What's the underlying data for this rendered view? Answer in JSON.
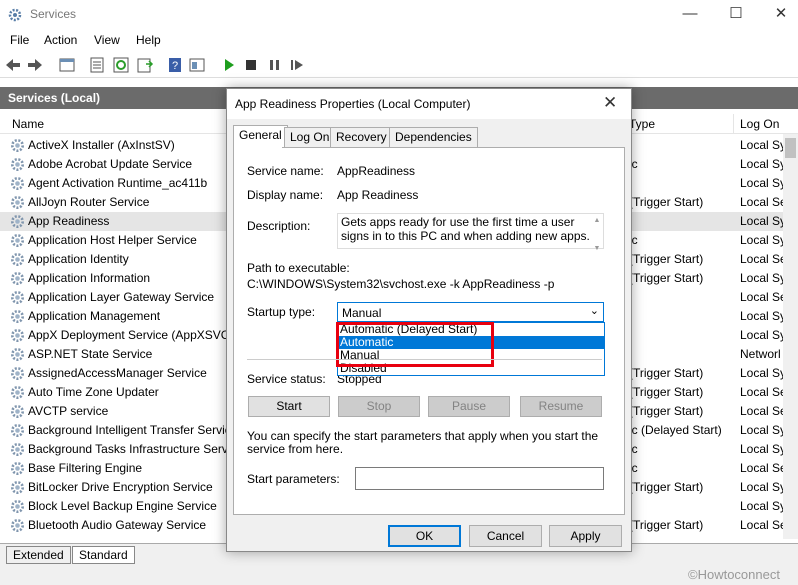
{
  "window": {
    "title": "Services",
    "minimize_glyph": "—",
    "maximize_glyph": "☐",
    "close_glyph": "✕"
  },
  "menu": [
    "File",
    "Action",
    "View",
    "Help"
  ],
  "scope_title": "Services (Local)",
  "columns": {
    "name": "Name",
    "startup": "Type",
    "logon": "Log On"
  },
  "services": [
    {
      "name": "ActiveX Installer (AxInstSV)",
      "startup": "",
      "logon": "Local Sy"
    },
    {
      "name": "Adobe Acrobat Update Service",
      "startup": "ic",
      "logon": "Local Sy"
    },
    {
      "name": "Agent Activation Runtime_ac411b",
      "startup": "",
      "logon": "Local Sy"
    },
    {
      "name": "AllJoyn Router Service",
      "startup": "(Trigger Start)",
      "logon": "Local Se"
    },
    {
      "name": "App Readiness",
      "startup": "",
      "logon": "Local Sy"
    },
    {
      "name": "Application Host Helper Service",
      "startup": "ic",
      "logon": "Local Sy"
    },
    {
      "name": "Application Identity",
      "startup": "(Trigger Start)",
      "logon": "Local Se"
    },
    {
      "name": "Application Information",
      "startup": "(Trigger Start)",
      "logon": "Local Sy"
    },
    {
      "name": "Application Layer Gateway Service",
      "startup": "",
      "logon": "Local Se"
    },
    {
      "name": "Application Management",
      "startup": "",
      "logon": "Local Sy"
    },
    {
      "name": "AppX Deployment Service (AppXSVC)",
      "startup": "",
      "logon": "Local Sy"
    },
    {
      "name": "ASP.NET State Service",
      "startup": "",
      "logon": "Networl"
    },
    {
      "name": "AssignedAccessManager Service",
      "startup": "(Trigger Start)",
      "logon": "Local Sy"
    },
    {
      "name": "Auto Time Zone Updater",
      "startup": "(Trigger Start)",
      "logon": "Local Se"
    },
    {
      "name": "AVCTP service",
      "startup": "(Trigger Start)",
      "logon": "Local Se"
    },
    {
      "name": "Background Intelligent Transfer Servic",
      "startup": "ic (Delayed Start)",
      "logon": "Local Sy"
    },
    {
      "name": "Background Tasks Infrastructure Servic",
      "startup": "ic",
      "logon": "Local Sy"
    },
    {
      "name": "Base Filtering Engine",
      "startup": "ic",
      "logon": "Local Se"
    },
    {
      "name": "BitLocker Drive Encryption Service",
      "startup": "(Trigger Start)",
      "logon": "Local Sy"
    },
    {
      "name": "Block Level Backup Engine Service",
      "startup": "",
      "logon": "Local Sy"
    },
    {
      "name": "Bluetooth Audio Gateway Service",
      "startup": "(Trigger Start)",
      "logon": "Local Se"
    }
  ],
  "bottom_tabs": [
    "Extended",
    "Standard"
  ],
  "watermark": "©Howtoconnect",
  "dialog": {
    "title": "App Readiness Properties (Local Computer)",
    "close_glyph": "✕",
    "tabs": [
      "General",
      "Log On",
      "Recovery",
      "Dependencies"
    ],
    "service_name_label": "Service name:",
    "service_name": "AppReadiness",
    "display_name_label": "Display name:",
    "display_name": "App Readiness",
    "description_label": "Description:",
    "description": "Gets apps ready for use the first time a user signs in to this PC and when adding new apps.",
    "path_label": "Path to executable:",
    "path": "C:\\WINDOWS\\System32\\svchost.exe -k AppReadiness -p",
    "startup_label": "Startup type:",
    "startup_value": "Manual",
    "startup_options": [
      "Automatic (Delayed Start)",
      "Automatic",
      "Manual",
      "Disabled"
    ],
    "highlighted_option": "Automatic",
    "status_label": "Service status:",
    "status_value": "Stopped",
    "buttons": {
      "start": "Start",
      "stop": "Stop",
      "pause": "Pause",
      "resume": "Resume"
    },
    "params_hint": "You can specify the start parameters that apply when you start the service from here.",
    "params_label": "Start parameters:",
    "params_value": "",
    "ok": "OK",
    "cancel": "Cancel",
    "apply": "Apply"
  },
  "colors": {
    "accent": "#0078d7",
    "highlight_box": "#e8000f",
    "scope_bar": "#6b6b6b"
  }
}
